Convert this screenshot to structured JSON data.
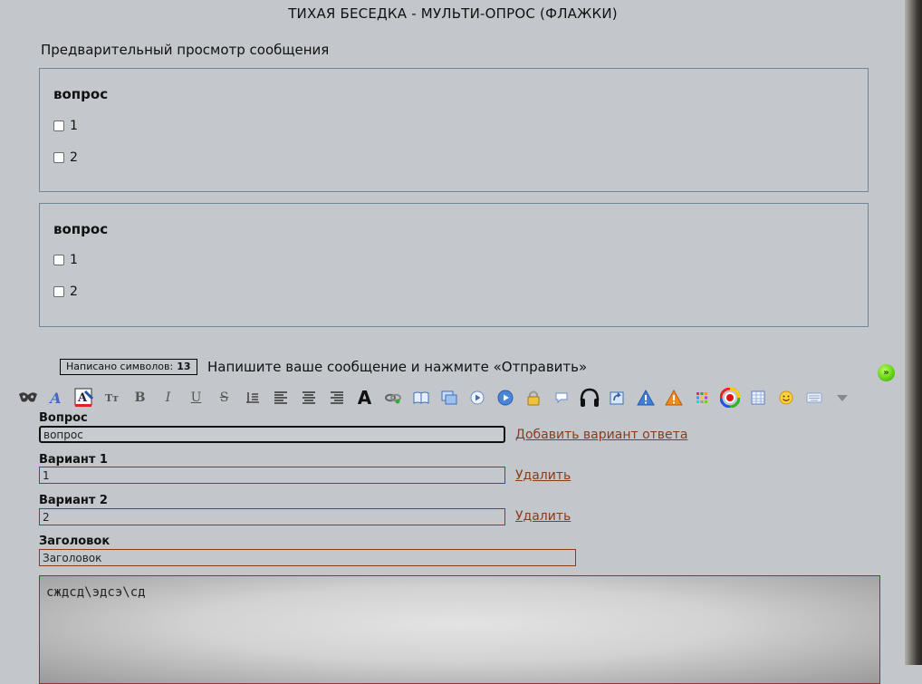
{
  "page": {
    "title": "ТИХАЯ БЕСЕДКА - МУЛЬТИ-ОПРОС (ФЛАЖКИ)",
    "preview_label": "Предварительный просмотр сообщения"
  },
  "preview_polls": [
    {
      "question": "вопрос",
      "options": [
        "1",
        "2"
      ]
    },
    {
      "question": "вопрос",
      "options": [
        "1",
        "2"
      ]
    }
  ],
  "status": {
    "counter_label": "Написано символов:",
    "counter_value": "13",
    "hint": "Напишите ваше сообщение и нажмите «Отправить»"
  },
  "toolbar": {
    "icons": [
      "mask-icon",
      "font-face-icon",
      "font-color-icon",
      "font-size-icon",
      "bold-icon",
      "italic-icon",
      "underline-icon",
      "strikethrough-icon",
      "indent-icon",
      "align-left-icon",
      "align-center-icon",
      "align-right-icon",
      "font-big-icon",
      "link-icon",
      "book-icon",
      "images-icon",
      "play-icon",
      "video-icon",
      "lock-icon",
      "speech-bubble-icon",
      "headphones-icon",
      "refresh-icon",
      "warning-blue-icon",
      "warning-orange-icon",
      "grid-icon",
      "color-wheel-icon",
      "table-icon",
      "smiley-icon",
      "keyboard-icon",
      "more-down-icon"
    ]
  },
  "form": {
    "question_label": "Вопрос",
    "question_value": "вопрос",
    "add_variant_link": "Добавить вариант ответа",
    "variants": [
      {
        "label": "Вариант 1",
        "value": "1",
        "delete_label": "Удалить"
      },
      {
        "label": "Вариант 2",
        "value": "2",
        "delete_label": "Удалить"
      }
    ],
    "heading_label": "Заголовок",
    "heading_value": "Заголовок"
  },
  "editor": {
    "content": "сждсд\\эдсэ\\сд"
  },
  "colors": {
    "background": "#c3c7cb",
    "link": "#8a3c1a",
    "border": "#6f8797"
  }
}
